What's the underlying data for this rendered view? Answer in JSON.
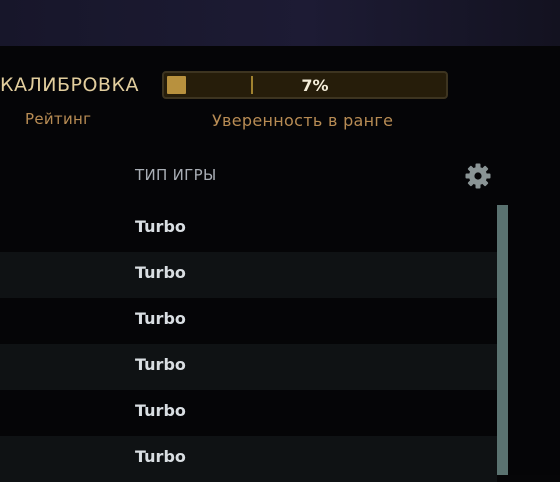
{
  "calibration": {
    "title": "КАЛИБРОВКА",
    "rating_label": "Рейтинг"
  },
  "confidence": {
    "percent_text": "7%",
    "percent": 7,
    "label": "Уверенность в ранге"
  },
  "table": {
    "column_header": "ТИП ИГРЫ",
    "settings_icon": "gear-icon",
    "rows": [
      "Turbo",
      "Turbo",
      "Turbo",
      "Turbo",
      "Turbo",
      "Turbo"
    ]
  },
  "colors": {
    "gold": "#e2ce9e",
    "bronze": "#b88c54",
    "bar_fill": "#b8913e",
    "scrollbar": "#5a7270"
  }
}
